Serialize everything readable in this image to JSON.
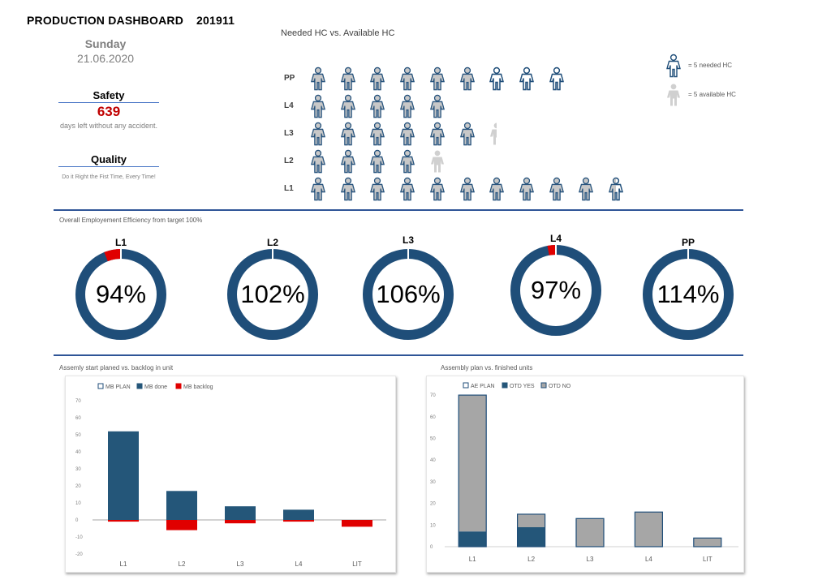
{
  "header": {
    "title": "PRODUCTION DASHBOARD",
    "period": "201911",
    "day": "Sunday",
    "date": "21.06.2020"
  },
  "safety": {
    "label": "Safety",
    "value": "639",
    "caption": "days left without any accident."
  },
  "quality": {
    "label": "Quality",
    "caption": "Do it Right the Fist Time, Every Time!"
  },
  "headcount": {
    "title": "Needed HC vs. Available HC",
    "unit_note": "each icon = 5 HC",
    "legend": [
      {
        "icon": "person-outline-icon",
        "label": "= 5 needed HC"
      },
      {
        "icon": "person-filled-icon",
        "label": "= 5 available HC"
      }
    ],
    "rows": [
      {
        "label": "PP",
        "available_icons": 6,
        "needed_icons": 9
      },
      {
        "label": "L4",
        "available_icons": 5.1,
        "needed_icons": 5
      },
      {
        "label": "L3",
        "available_icons": 6.5,
        "needed_icons": 6
      },
      {
        "label": "L2",
        "available_icons": 5,
        "needed_icons": 4
      },
      {
        "label": "L1",
        "available_icons": 10.5,
        "needed_icons": 11
      }
    ]
  },
  "colors": {
    "navy": "#1f4e79",
    "done": "#245679",
    "red": "#e00000",
    "gray": "#a6a6a6",
    "accent_line": "#2f5597"
  },
  "efficiency": {
    "title": "Overall Employement Efficiency from target 100%",
    "items": [
      {
        "label": "L1",
        "value": 94,
        "text": "94%"
      },
      {
        "label": "L2",
        "value": 102,
        "text": "102%"
      },
      {
        "label": "L3",
        "value": 106,
        "text": "106%"
      },
      {
        "label": "L4",
        "value": 97,
        "text": "97%"
      },
      {
        "label": "PP",
        "value": 114,
        "text": "114%"
      }
    ]
  },
  "chart_data": [
    {
      "type": "bar",
      "title": "Assemly start planed vs. backlog in unit",
      "categories": [
        "L1",
        "L2",
        "L3",
        "L4",
        "LIT"
      ],
      "series": [
        {
          "name": "MB PLAN",
          "values": [
            null,
            null,
            null,
            null,
            null
          ]
        },
        {
          "name": "MB done",
          "values": [
            52,
            17,
            8,
            6,
            0
          ]
        },
        {
          "name": "MB backlog",
          "values": [
            -1,
            -6,
            -2,
            -1,
            -4
          ]
        }
      ],
      "ylim": [
        -20,
        70
      ],
      "yticks": [
        -20,
        -10,
        0,
        10,
        20,
        30,
        40,
        50,
        60,
        70
      ],
      "legend": "top-left",
      "grid": false
    },
    {
      "type": "bar",
      "stacked": true,
      "title": "Assembly plan vs. finished units",
      "categories": [
        "L1",
        "L2",
        "L3",
        "L4",
        "LIT"
      ],
      "series": [
        {
          "name": "AE PLAN",
          "values": [
            70,
            15,
            13,
            16,
            4
          ]
        },
        {
          "name": "OTD YES",
          "values": [
            7,
            9,
            0,
            0,
            0
          ]
        },
        {
          "name": "OTD NO",
          "values": [
            63,
            6,
            13,
            16,
            4
          ]
        }
      ],
      "ylim": [
        0,
        70
      ],
      "yticks": [
        0,
        10,
        20,
        30,
        40,
        50,
        60,
        70
      ],
      "legend": "top-left",
      "grid": false
    }
  ]
}
